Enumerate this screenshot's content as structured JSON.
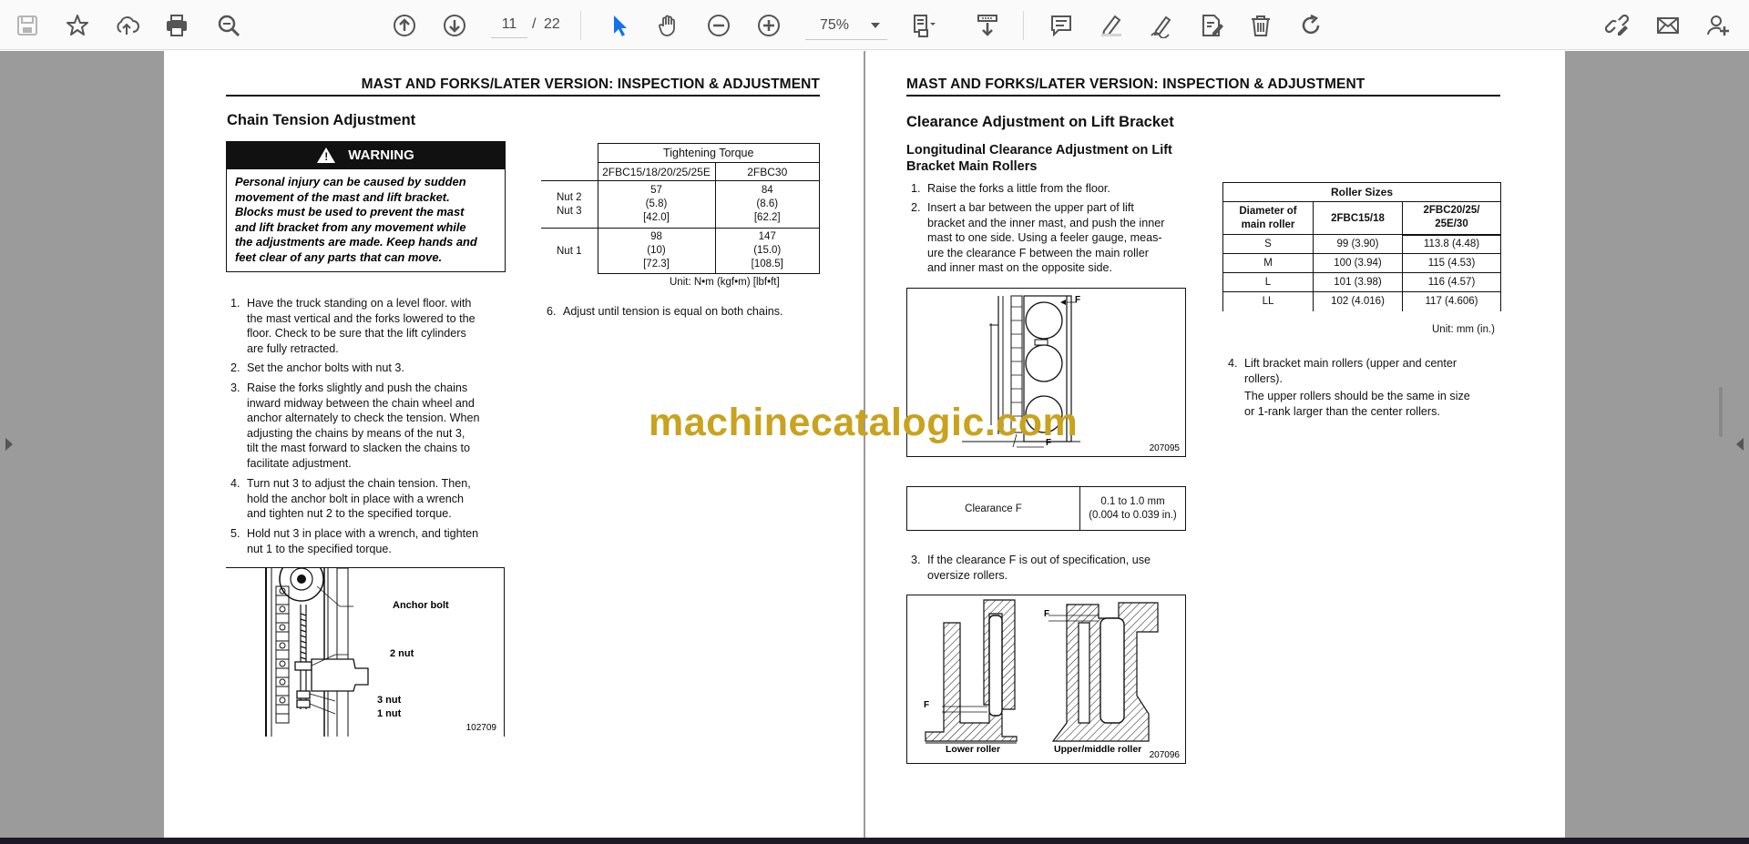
{
  "toolbar": {
    "page_current": "11",
    "page_separator": "/",
    "page_total": "22",
    "zoom": "75%"
  },
  "watermark": "machinecatalogic.com",
  "left_page": {
    "header": "MAST AND FORKS/LATER VERSION: INSPECTION & ADJUSTMENT",
    "title": "Chain Tension Adjustment",
    "warning_label": "WARNING",
    "warning_lines": [
      "Personal injury can be caused by sudden",
      "movement of the mast and lift bracket.",
      "Blocks must be used to prevent the mast",
      "and lift bracket from any movement while",
      "the adjustments are made. Keep hands and",
      "feet clear of any parts that can move."
    ],
    "steps": [
      {
        "num": "1.",
        "lines": [
          "Have the truck standing on a level floor. with",
          "the mast vertical and the forks lowered to the",
          "floor. Check to be sure that the lift cylinders",
          "are fully retracted."
        ]
      },
      {
        "num": "2.",
        "lines": [
          "Set the anchor bolts with nut 3."
        ]
      },
      {
        "num": "3.",
        "lines": [
          "Raise the forks slightly and push the chains",
          "inward midway between the chain wheel and",
          "anchor alternately to check the tension. When",
          "adjusting the chains by means of the nut 3,",
          "tilt the mast forward to slacken the chains to",
          "facilitate adjustment."
        ]
      },
      {
        "num": "4.",
        "lines": [
          "Turn nut 3 to adjust the chain tension. Then,",
          "hold the anchor bolt in place with a wrench",
          "and tighten nut 2 to the specified torque."
        ]
      },
      {
        "num": "5.",
        "lines": [
          "Hold nut 3 in place with a wrench, and tighten",
          "nut 1 to the specified torque."
        ]
      }
    ],
    "step6": {
      "num": "6.",
      "text": "Adjust until tension is equal on both chains."
    },
    "torque_table": {
      "title": "Tightening Torque",
      "col1": "2FBC15/18/20/25/25E",
      "col2": "2FBC30",
      "rows": [
        {
          "label": [
            "Nut 2",
            "Nut 3"
          ],
          "c1": [
            "57",
            "(5.8)",
            "[42.0]"
          ],
          "c2": [
            "84",
            "(8.6)",
            "[62.2]"
          ]
        },
        {
          "label": [
            "Nut 1"
          ],
          "c1": [
            "98",
            "(10)",
            "[72.3]"
          ],
          "c2": [
            "147",
            "(15.0)",
            "[108.5]"
          ]
        }
      ],
      "unit": "Unit: N•m (kgf•m) [lbf•ft]"
    },
    "figure": {
      "labels": [
        "Anchor bolt",
        "2 nut",
        "3 nut",
        "1 nut"
      ],
      "code": "102709"
    }
  },
  "right_page": {
    "header": "MAST AND FORKS/LATER VERSION: INSPECTION & ADJUSTMENT",
    "title": "Clearance Adjustment on Lift Bracket",
    "subtitle": [
      "Longitudinal Clearance Adjustment on Lift",
      "Bracket Main Rollers"
    ],
    "steps": [
      {
        "num": "1.",
        "lines": [
          "Raise the forks a little from the floor."
        ]
      },
      {
        "num": "2.",
        "lines": [
          "Insert a bar between the upper part of lift",
          "bracket and the inner mast, and push the inner",
          "mast to one side. Using a feeler gauge, meas-",
          "ure the clearance F between the main roller",
          "and inner mast on the opposite side."
        ]
      }
    ],
    "figure1": {
      "label_f": "F",
      "code": "207095"
    },
    "clearance_table": {
      "label": "Clearance F",
      "value": [
        "0.1 to 1.0 mm",
        "(0.004 to 0.039 in.)"
      ]
    },
    "step3": {
      "num": "3.",
      "lines": [
        "If the clearance F is out of specification, use",
        "oversize rollers."
      ]
    },
    "figure2": {
      "label_f": "F",
      "lower": "Lower roller",
      "upper": "Upper/middle roller",
      "code": "207096"
    },
    "roller_table": {
      "title": "Roller Sizes",
      "headers": [
        [
          "Diameter of",
          "main roller"
        ],
        [
          "2FBC15/18"
        ],
        [
          "2FBC20/25/",
          "25E/30"
        ]
      ],
      "rows": [
        [
          "S",
          "99 (3.90)",
          "113.8 (4.48)"
        ],
        [
          "M",
          "100 (3.94)",
          "115 (4.53)"
        ],
        [
          "L",
          "101 (3.98)",
          "116 (4.57)"
        ],
        [
          "LL",
          "102 (4.016)",
          "117 (4.606)"
        ]
      ],
      "unit": "Unit: mm (in.)"
    },
    "step4": {
      "num": "4.",
      "lines": [
        "Lift bracket main rollers (upper and center",
        "rollers).",
        "The upper rollers should be the same in size",
        "or 1-rank larger than the center rollers."
      ]
    }
  }
}
